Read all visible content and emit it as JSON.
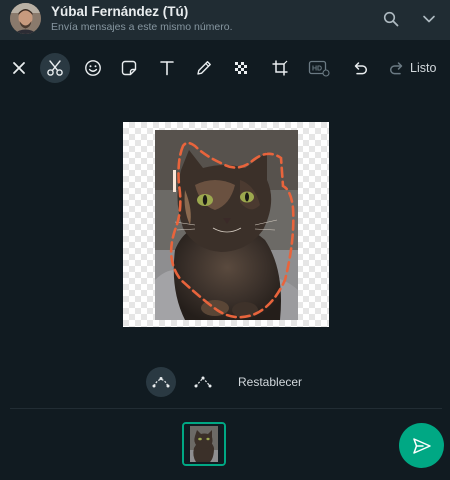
{
  "header": {
    "contact_name": "Yúbal Fernández (Tú)",
    "contact_subtitle": "Envía mensajes a este mismo número.",
    "icons": [
      "avatar",
      "search-icon",
      "chevron-down-icon"
    ]
  },
  "toolbar": {
    "tools": [
      "close-icon",
      "scissors-icon",
      "emoji-icon",
      "sticker-icon",
      "text-icon",
      "pencil-icon",
      "blur-icon",
      "crop-icon",
      "hd-icon",
      "undo-icon",
      "redo-icon"
    ],
    "active_tool": "scissors-icon",
    "done_label": "Listo"
  },
  "editor": {
    "outline_color": "#e8643c",
    "modes": [
      "curve-select-icon",
      "polygon-select-icon"
    ],
    "active_mode": "curve-select-icon",
    "reset_label": "Restablecer"
  },
  "footer": {
    "accent": "#00a884",
    "icons": [
      "image-thumbnail",
      "send-icon"
    ]
  }
}
